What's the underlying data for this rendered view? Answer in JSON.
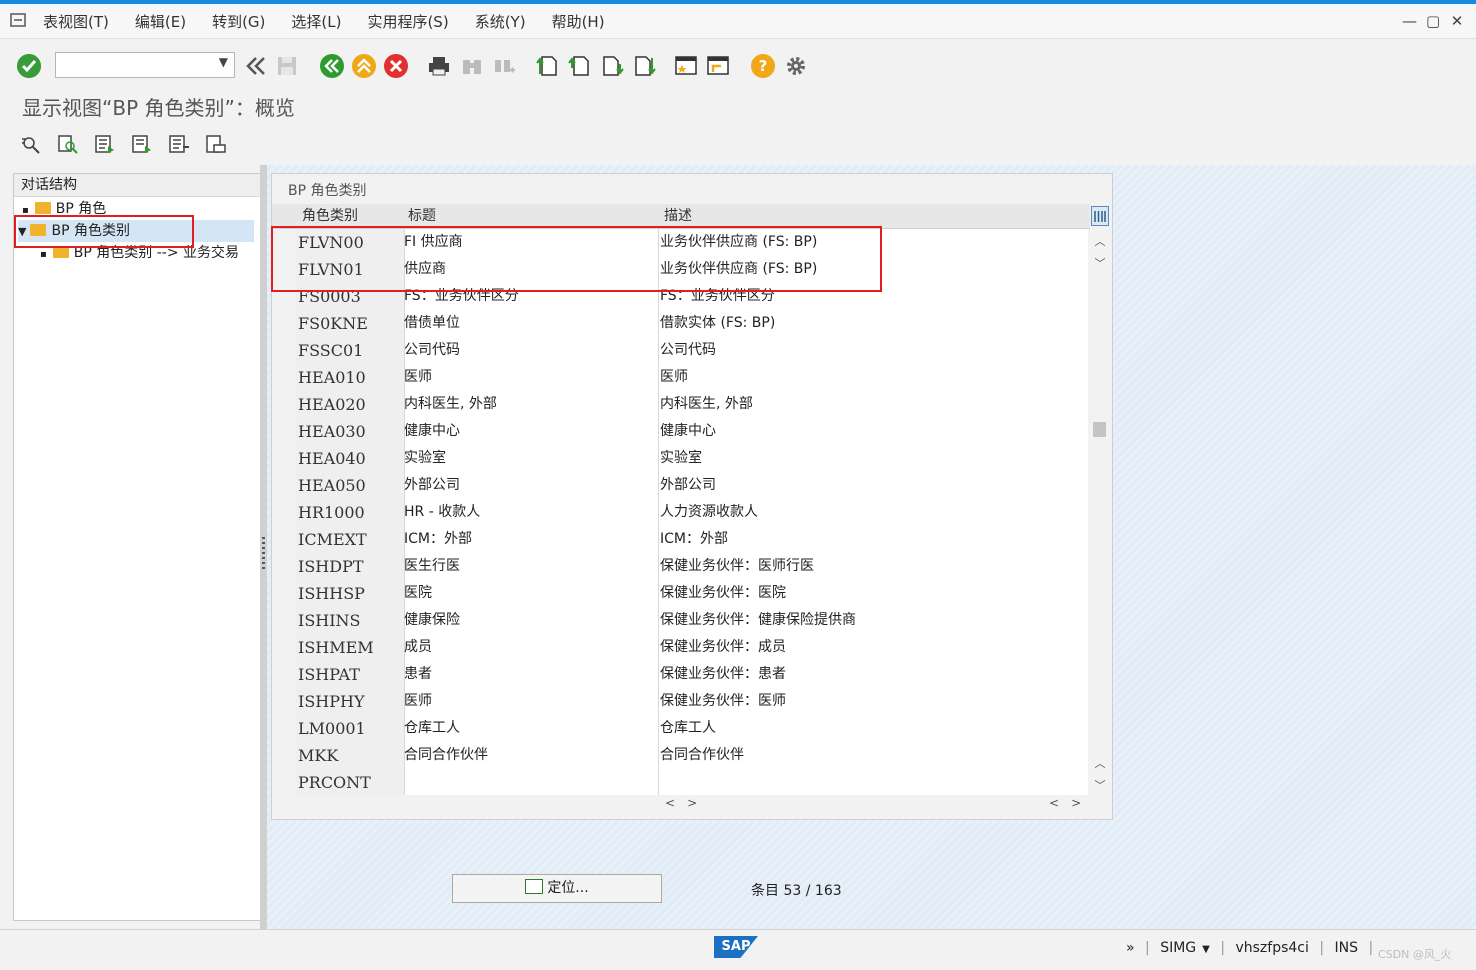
{
  "menu": {
    "items": [
      "表视图(T)",
      "编辑(E)",
      "转到(G)",
      "选择(L)",
      "实用程序(S)",
      "系统(Y)",
      "帮助(H)"
    ]
  },
  "window": {
    "minimize": "—",
    "restore": "▢",
    "close": "✕"
  },
  "toolbar": {
    "command_field": "",
    "colors": {
      "ok": "#3a9b3a",
      "back": "#2e9b2e",
      "exit": "#f0a818",
      "cancel": "#e03030",
      "help": "#f0a818"
    }
  },
  "view_title": "显示视图“BP 角色类别”：概览",
  "tree": {
    "header": "对话结构",
    "items": [
      {
        "label": "BP 角色",
        "level": 0,
        "expanded": false
      },
      {
        "label": "BP 角色类别",
        "level": 0,
        "expanded": true,
        "selected": true
      },
      {
        "label": "BP 角色类别 --> 业务交易",
        "level": 1,
        "expanded": false
      }
    ]
  },
  "table": {
    "caption": "BP 角色类别",
    "columns": [
      "角色类别",
      "标题",
      "描述"
    ],
    "rows": [
      [
        "FLVN00",
        "FI 供应商",
        "业务伙伴供应商 (FS: BP)"
      ],
      [
        "FLVN01",
        "供应商",
        "业务伙伴供应商 (FS: BP)"
      ],
      [
        "FS0003",
        "FS：业务伙伴区分",
        "FS：业务伙伴区分"
      ],
      [
        "FS0KNE",
        "借债单位",
        "借款实体 (FS: BP)"
      ],
      [
        "FSSC01",
        "公司代码",
        "公司代码"
      ],
      [
        "HEA010",
        "医师",
        "医师"
      ],
      [
        "HEA020",
        "内科医生, 外部",
        "内科医生, 外部"
      ],
      [
        "HEA030",
        "健康中心",
        "健康中心"
      ],
      [
        "HEA040",
        "实验室",
        "实验室"
      ],
      [
        "HEA050",
        "外部公司",
        "外部公司"
      ],
      [
        "HR1000",
        "HR - 收款人",
        "人力资源收款人"
      ],
      [
        "ICMEXT",
        "ICM：外部",
        "ICM：外部"
      ],
      [
        "ISHDPT",
        "医生行医",
        "保健业务伙伴：医师行医"
      ],
      [
        "ISHHSP",
        "医院",
        "保健业务伙伴：医院"
      ],
      [
        "ISHINS",
        "健康保险",
        "保健业务伙伴：健康保险提供商"
      ],
      [
        "ISHMEM",
        "成员",
        "保健业务伙伴：成员"
      ],
      [
        "ISHPAT",
        "患者",
        "保健业务伙伴：患者"
      ],
      [
        "ISHPHY",
        "医师",
        "保健业务伙伴：医师"
      ],
      [
        "LM0001",
        "仓库工人",
        "仓库工人"
      ],
      [
        "MKK",
        "合同合作伙伴",
        "合同合作伙伴"
      ],
      [
        "PRCONT",
        "",
        ""
      ]
    ]
  },
  "position_button": "定位...",
  "entry": {
    "label": "条目",
    "current": "53",
    "total": "163"
  },
  "status": {
    "logo": "SAP",
    "expand": "»",
    "tcode": "SIMG",
    "server": "vhszfps4ci",
    "mode": "INS"
  },
  "watermark": "CSDN @风_火"
}
